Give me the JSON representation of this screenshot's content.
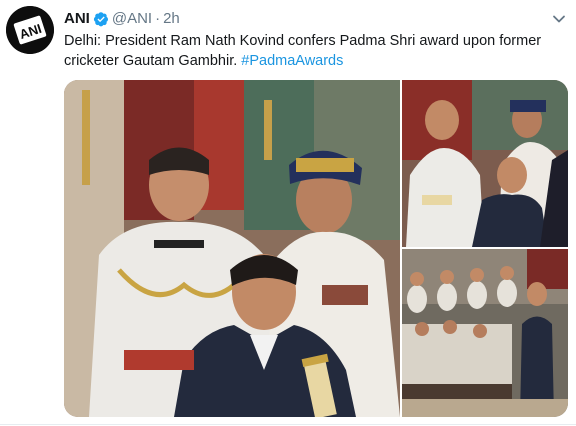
{
  "author": {
    "name": "ANI",
    "handle": "@ANI",
    "separator": "·",
    "time": "2h",
    "avatar_text": "ANI",
    "verified": true
  },
  "tweet": {
    "text": "Delhi: President Ram Nath Kovind confers Padma Shri award upon former cricketer Gautam Gambhir.",
    "hashtag": "#PadmaAwards"
  },
  "icons": {
    "verified": "verified-badge-icon",
    "caret": "chevron-down-icon"
  },
  "colors": {
    "accent": "#1da1f2",
    "hashtag": "#1b95e0",
    "text": "#14171a",
    "secondary": "#657786"
  },
  "media": {
    "count": 3,
    "photos": [
      "Award ceremony photo: Gautam Gambhir holding the scroll",
      "Photo: Gambhir receiving the award",
      "Photo: hall audience during the ceremony"
    ]
  }
}
